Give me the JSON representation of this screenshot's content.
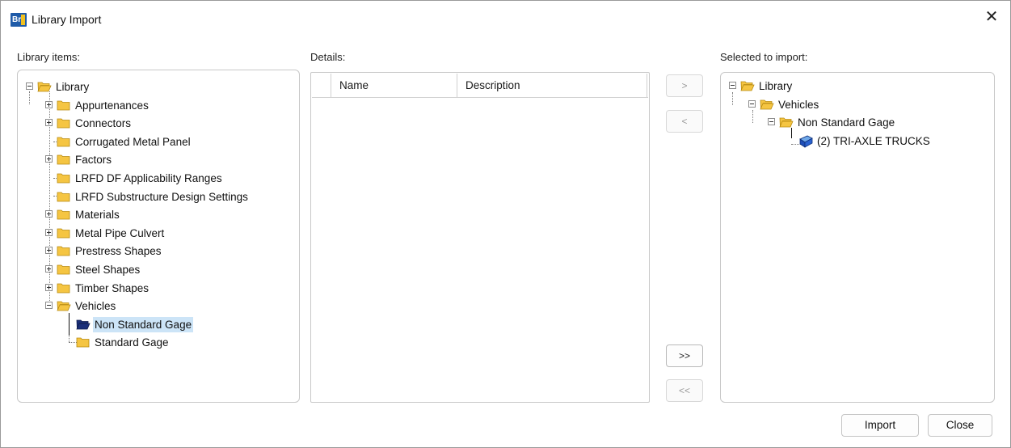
{
  "window": {
    "title": "Library Import",
    "app_badge": "Br"
  },
  "labels": {
    "library_items": "Library items:",
    "details": "Details:",
    "selected_to_import": "Selected to import:"
  },
  "library_tree": [
    {
      "label": "Library",
      "expander": "minus"
    },
    {
      "label": "Appurtenances",
      "expander": "plus"
    },
    {
      "label": "Connectors",
      "expander": "plus"
    },
    {
      "label": "Corrugated Metal Panel",
      "expander": "none"
    },
    {
      "label": "Factors",
      "expander": "plus"
    },
    {
      "label": "LRFD DF Applicability Ranges",
      "expander": "none"
    },
    {
      "label": "LRFD Substructure Design Settings",
      "expander": "none"
    },
    {
      "label": "Materials",
      "expander": "plus"
    },
    {
      "label": "Metal Pipe Culvert",
      "expander": "plus"
    },
    {
      "label": "Prestress Shapes",
      "expander": "plus"
    },
    {
      "label": "Steel Shapes",
      "expander": "plus"
    },
    {
      "label": "Timber Shapes",
      "expander": "plus"
    },
    {
      "label": "Vehicles",
      "expander": "minus"
    },
    {
      "label": "Non Standard Gage",
      "expander": "none",
      "selected": true
    },
    {
      "label": "Standard Gage",
      "expander": "none"
    }
  ],
  "details_grid": {
    "columns": [
      "Name",
      "Description"
    ]
  },
  "selected_tree": [
    {
      "label": "Library"
    },
    {
      "label": "Vehicles"
    },
    {
      "label": "Non Standard Gage"
    },
    {
      "label": "(2) TRI-AXLE TRUCKS"
    }
  ],
  "move_buttons": {
    "add": ">",
    "remove": "<",
    "add_all": ">>",
    "remove_all": "<<"
  },
  "footer": {
    "import_label": "Import",
    "close_label": "Close"
  },
  "icons": {
    "app": "bridge-app-icon",
    "close": "close-icon",
    "folder": "folder-icon",
    "vehicle": "vehicle-book-icon"
  },
  "colors": {
    "folder_fill": "#f5c542",
    "folder_selected": "#1b2f7a",
    "selection_bg": "#cce4f7"
  }
}
